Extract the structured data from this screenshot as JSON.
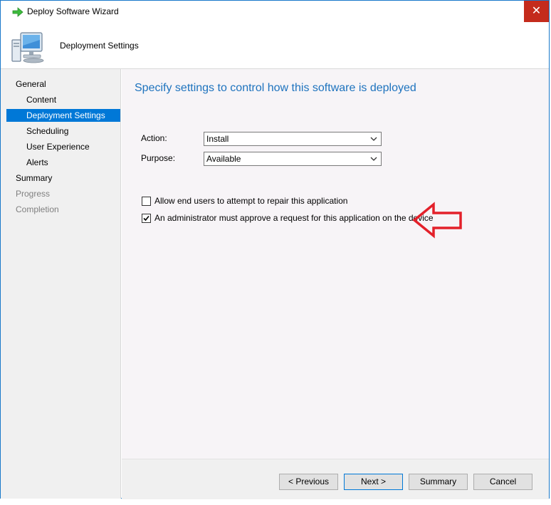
{
  "window": {
    "title": "Deploy Software Wizard",
    "close_glyph": "✕"
  },
  "header": {
    "title": "Deployment Settings",
    "icon": "computer-icon"
  },
  "nav": {
    "items": [
      {
        "label": "General"
      },
      {
        "label": "Content"
      },
      {
        "label": "Deployment Settings"
      },
      {
        "label": "Scheduling"
      },
      {
        "label": "User Experience"
      },
      {
        "label": "Alerts"
      },
      {
        "label": "Summary"
      },
      {
        "label": "Progress"
      },
      {
        "label": "Completion"
      }
    ]
  },
  "main": {
    "heading": "Specify settings to control how this software is deployed",
    "action": {
      "label": "Action:",
      "value": "Install"
    },
    "purpose": {
      "label": "Purpose:",
      "value": "Available"
    },
    "checkboxes": [
      {
        "label": "Allow end users to attempt to repair this application",
        "checked": false
      },
      {
        "label": "An administrator must approve a request for this application on the device",
        "checked": true
      }
    ]
  },
  "footer": {
    "previous_label": "< Previous",
    "next_label": "Next >",
    "summary_label": "Summary",
    "cancel_label": "Cancel"
  },
  "colors": {
    "accent": "#0078d7",
    "heading": "#1e73be",
    "close": "#c42b1c",
    "annotation_arrow": "#e3202a"
  }
}
